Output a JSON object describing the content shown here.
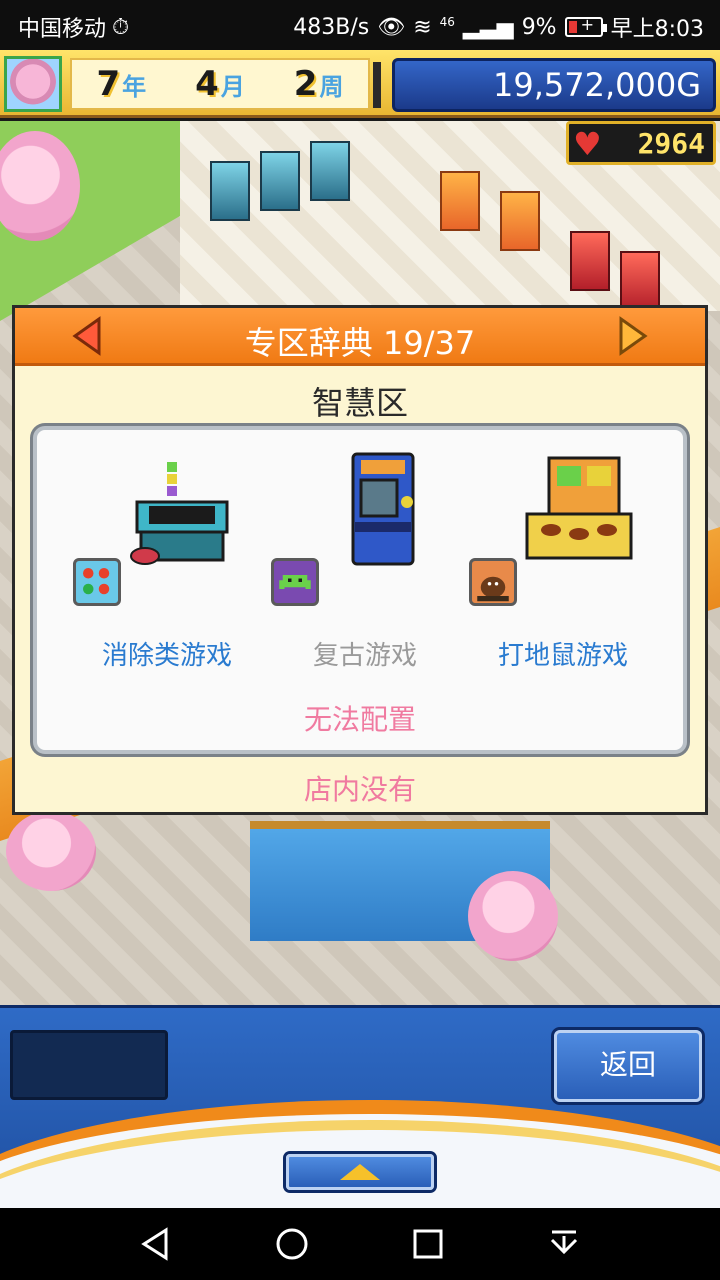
{
  "status_bar": {
    "carrier": "中国移动",
    "speed": "483B/s",
    "network": "46",
    "battery": "9%",
    "time": "早上8:03"
  },
  "hud": {
    "year_num": "7",
    "year_unit": "年",
    "month_num": "4",
    "month_unit": "月",
    "week_num": "2",
    "week_unit": "周",
    "money": "19,572,000G",
    "popularity": "2964"
  },
  "dialog": {
    "title": "专区辞典 19/37",
    "zone_name": "智慧区",
    "games": [
      {
        "label": "消除类游戏",
        "available": true,
        "icon": "puzzle-icon"
      },
      {
        "label": "复古游戏",
        "available": false,
        "icon": "space-invader-icon"
      },
      {
        "label": "打地鼠游戏",
        "available": true,
        "icon": "mole-icon"
      }
    ],
    "panel_status": "无法配置",
    "footer_status": "店内没有"
  },
  "bottom": {
    "back_label": "返回"
  },
  "colors": {
    "header_orange": "#f07a14",
    "available_blue": "#2a7bd0",
    "unavailable_gray": "#9a9a9a",
    "status_pink": "#f07aa0",
    "money_blue": "#1b3a8a"
  }
}
